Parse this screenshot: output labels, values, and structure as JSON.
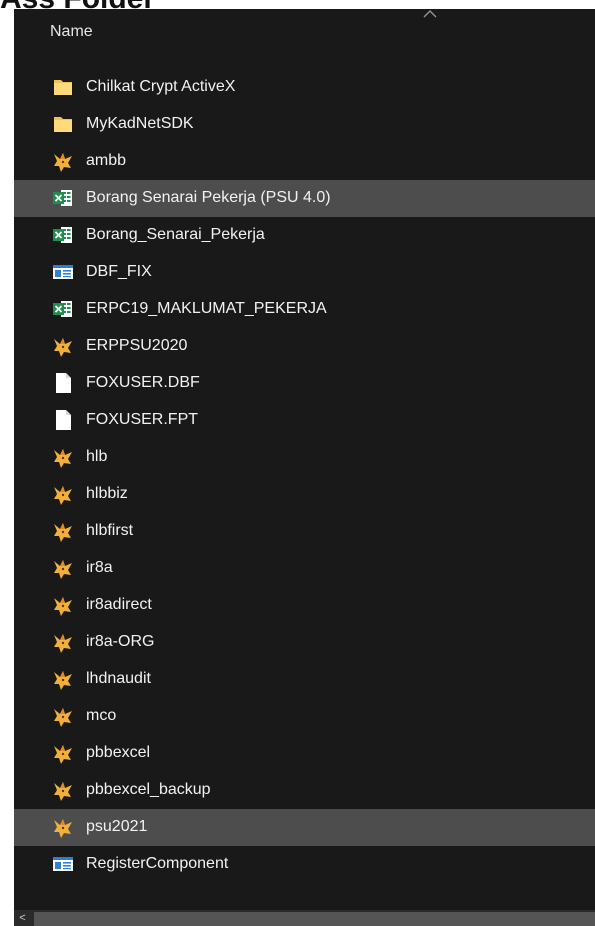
{
  "header": {
    "partial_title": "Ass Folder",
    "column_name": "Name"
  },
  "colors": {
    "pane_background": "#191919",
    "selected_row": "#4d4d4d",
    "folder": "#f2c154",
    "excel": "#1d8f4e",
    "fox": "#f0b03a"
  },
  "files": [
    {
      "name": "Chilkat Crypt ActiveX",
      "icon": "folder-icon",
      "selected": false
    },
    {
      "name": "MyKadNetSDK",
      "icon": "folder-icon",
      "selected": false
    },
    {
      "name": "ambb",
      "icon": "foxpro-icon",
      "selected": false
    },
    {
      "name": "Borang Senarai Pekerja (PSU 4.0)",
      "icon": "excel-icon",
      "selected": true
    },
    {
      "name": "Borang_Senarai_Pekerja",
      "icon": "excel-icon",
      "selected": false
    },
    {
      "name": "DBF_FIX",
      "icon": "application-icon",
      "selected": false
    },
    {
      "name": "ERPC19_MAKLUMAT_PEKERJA",
      "icon": "excel-icon",
      "selected": false
    },
    {
      "name": "ERPPSU2020",
      "icon": "foxpro-icon",
      "selected": false
    },
    {
      "name": "FOXUSER.DBF",
      "icon": "document-icon",
      "selected": false
    },
    {
      "name": "FOXUSER.FPT",
      "icon": "document-icon",
      "selected": false
    },
    {
      "name": "hlb",
      "icon": "foxpro-icon",
      "selected": false
    },
    {
      "name": "hlbbiz",
      "icon": "foxpro-icon",
      "selected": false
    },
    {
      "name": "hlbfirst",
      "icon": "foxpro-icon",
      "selected": false
    },
    {
      "name": "ir8a",
      "icon": "foxpro-icon",
      "selected": false
    },
    {
      "name": "ir8adirect",
      "icon": "foxpro-icon",
      "selected": false
    },
    {
      "name": "ir8a-ORG",
      "icon": "foxpro-icon",
      "selected": false
    },
    {
      "name": "lhdnaudit",
      "icon": "foxpro-icon",
      "selected": false
    },
    {
      "name": "mco",
      "icon": "foxpro-icon",
      "selected": false
    },
    {
      "name": "pbbexcel",
      "icon": "foxpro-icon",
      "selected": false
    },
    {
      "name": "pbbexcel_backup",
      "icon": "foxpro-icon",
      "selected": false
    },
    {
      "name": "psu2021",
      "icon": "foxpro-icon",
      "selected": true
    },
    {
      "name": "RegisterComponent",
      "icon": "application-icon",
      "selected": false
    }
  ],
  "scrollbar": {
    "left_arrow": "<"
  }
}
